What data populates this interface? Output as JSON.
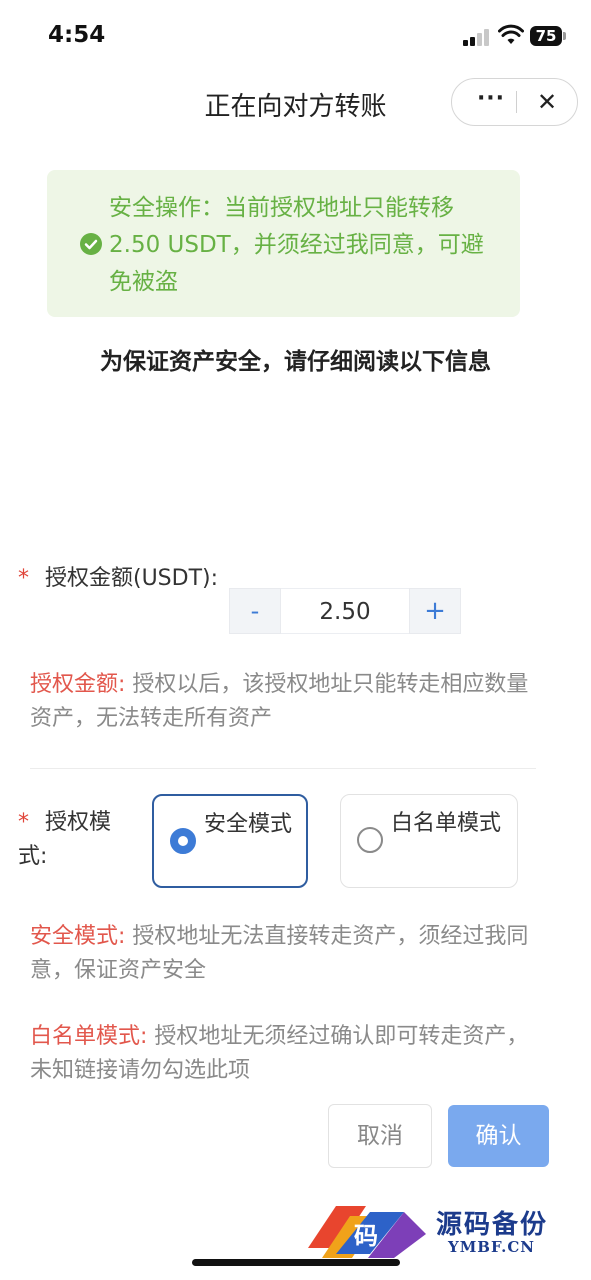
{
  "status_bar": {
    "time": "4:54",
    "battery": "75"
  },
  "header": {
    "title": "正在向对方转账",
    "more_label": "···",
    "close_label": "✕"
  },
  "notice": {
    "text": "安全操作：当前授权地址只能转移2.50 USDT，并须经过我同意，可避免被盗",
    "color": "#67b144",
    "background": "#eef6e6",
    "icon": "check-circle-icon"
  },
  "intro_text": "为保证资产安全，请仔细阅读以下信息",
  "amount": {
    "required_mark": "*",
    "label": "授权金额(USDT):",
    "minus_label": "-",
    "value": "2.50",
    "plus_label": "+",
    "desc_key": "授权金额:",
    "desc_text": "授权以后，该授权地址只能转走相应数量资产，无法转走所有资产"
  },
  "mode": {
    "required_mark": "*",
    "label": "授权模式:",
    "options": [
      {
        "label": "安全模式",
        "selected": true
      },
      {
        "label": "白名单模式",
        "selected": false
      }
    ],
    "safe_desc_key": "安全模式:",
    "safe_desc_text": "授权地址无法直接转走资产，须经过我同意，保证资产安全",
    "white_desc_key": "白名单模式:",
    "white_desc_text": "授权地址无须经过确认即可转走资产，未知链接请勿勾选此项"
  },
  "actions": {
    "cancel_label": "取消",
    "confirm_label": "确认",
    "confirm_color": "#7aa9ee"
  },
  "watermark": {
    "logo_char": "码",
    "title": "源码备份",
    "subtitle": "YMBF.CN"
  },
  "colors": {
    "accent": "#3d7bd6",
    "required": "#e0453a",
    "key_text": "#e2574c",
    "selected_border": "#2f5da0"
  }
}
